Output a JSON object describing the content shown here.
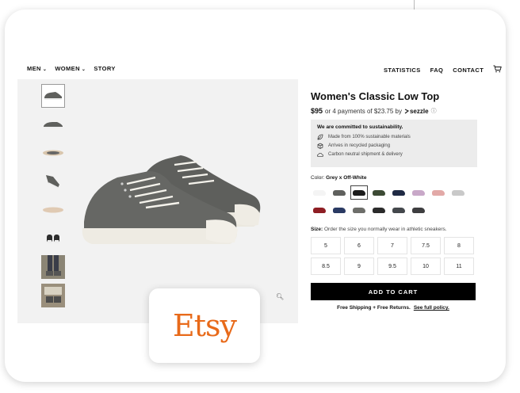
{
  "nav": {
    "left": [
      {
        "label": "MEN",
        "dropdown": true
      },
      {
        "label": "WOMEN",
        "dropdown": true
      },
      {
        "label": "STORY",
        "dropdown": false
      }
    ],
    "right": [
      "STATISTICS",
      "FAQ",
      "CONTACT"
    ],
    "cart_icon": "cart-icon"
  },
  "product": {
    "title": "Women's Classic Low Top",
    "price": "$95",
    "installments": "or 4 payments of $23.75 by",
    "sezzle": "sezzle",
    "info_icon": "ⓘ",
    "sustainability": {
      "heading": "We are committed to sustainability.",
      "items": [
        {
          "icon": "leaf-icon",
          "text": "Made from 100% sustainable materials"
        },
        {
          "icon": "box-icon",
          "text": "Arrives in recycled packaging"
        },
        {
          "icon": "cloud-icon",
          "text": "Carbon neutral shipment & delivery"
        }
      ]
    },
    "color_label": "Color:",
    "color_value": "Grey x Off-White",
    "swatches": [
      "#f4f4f4",
      "#5f605d",
      "#1c1c1c",
      "#3c4a34",
      "#1f2a44",
      "#c8a8c8",
      "#e2a9a7",
      "#c9c9c9",
      "#8e1e24",
      "#2a3a63",
      "#6d6e6a",
      "#2b2b2b",
      "#44484c",
      "#3e3e40"
    ],
    "selected_swatch": 2,
    "size_label": "Size:",
    "size_hint": "Order the size you normally wear in athletic sneakers.",
    "sizes": [
      "5",
      "6",
      "7",
      "7.5",
      "8",
      "8.5",
      "9",
      "9.5",
      "10",
      "11"
    ],
    "cart_button": "ADD TO CART",
    "shipping": "Free Shipping + Free Returns.",
    "policy_link": "See full policy."
  },
  "etsy_logo": "Etsy"
}
